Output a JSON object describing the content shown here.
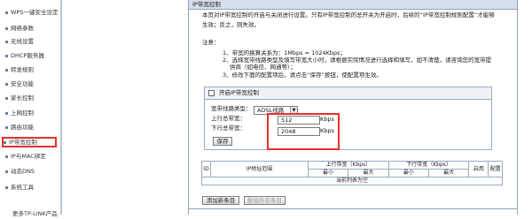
{
  "sidebar": {
    "items": [
      {
        "label": "WPS一键安全设定"
      },
      {
        "label": "网络参数"
      },
      {
        "label": "无线设置"
      },
      {
        "label": "DHCP服务器"
      },
      {
        "label": "转发规则"
      },
      {
        "label": "安全功能"
      },
      {
        "label": "家长控制"
      },
      {
        "label": "上网控制"
      },
      {
        "label": "路由功能"
      },
      {
        "label": "IP带宽控制"
      },
      {
        "label": "IP与MAC绑定"
      },
      {
        "label": "动态DNS"
      },
      {
        "label": "系统工具"
      },
      {
        "label": "更多TP-LINK产品"
      }
    ]
  },
  "panel": {
    "title": "IP带宽控制",
    "description": [
      "本页对IP带宽控制的开启与关闭进行设置。只有IP带宽控制的总开关为开启时，后续的“IP带宽控制规则配置”才能够",
      "生效；反之，则失效。"
    ],
    "notes_title": "注意：",
    "notes": [
      "1、带宽的换算关系为：1Mbps = 1024Kbps；",
      "2、选择宽带线路类型及填写带宽大小时，请根据实际情况进行选择和填写，如不清楚，请咨询您的宽带提",
      "供商（如电信、网通等）；",
      "3、修改下面的配置项后，请点击“保存”按钮，使配置项生效。"
    ]
  },
  "settings": {
    "enable_label": "开启IP带宽控制",
    "line_type_label": "宽带线路类型：",
    "line_type_value": "ADSL线路",
    "up_label": "上行总带宽：",
    "up_value": "512",
    "up_unit": "Kbps",
    "down_label": "下行总带宽：",
    "down_value": "2048",
    "down_unit": "Kbps",
    "save_label": "保存"
  },
  "table": {
    "headers": {
      "id": "ID",
      "ip_range": "IP地址范围",
      "up": "上行带宽（Kbps）",
      "down": "下行带宽（Kbps）",
      "enable": "启用",
      "config": "配置"
    },
    "sub_headers": {
      "min": "最小",
      "max": "最大"
    },
    "empty_text": "当前列表为空"
  },
  "buttons": {
    "add": "添加新条目",
    "delete_all": "删除所有条目"
  },
  "colors": {
    "highlight": "#e8302a",
    "title_bar": "#d6e0ec"
  }
}
